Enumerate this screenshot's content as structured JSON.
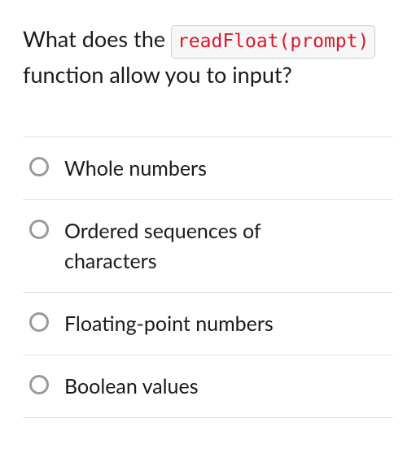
{
  "question": {
    "pre": "What does the",
    "code": "readFloat(prompt)",
    "post": "function allow you to input?"
  },
  "choices": [
    {
      "label": "Whole numbers"
    },
    {
      "label": "Ordered sequences of characters"
    },
    {
      "label": "Floating-point numbers"
    },
    {
      "label": "Boolean values"
    }
  ]
}
